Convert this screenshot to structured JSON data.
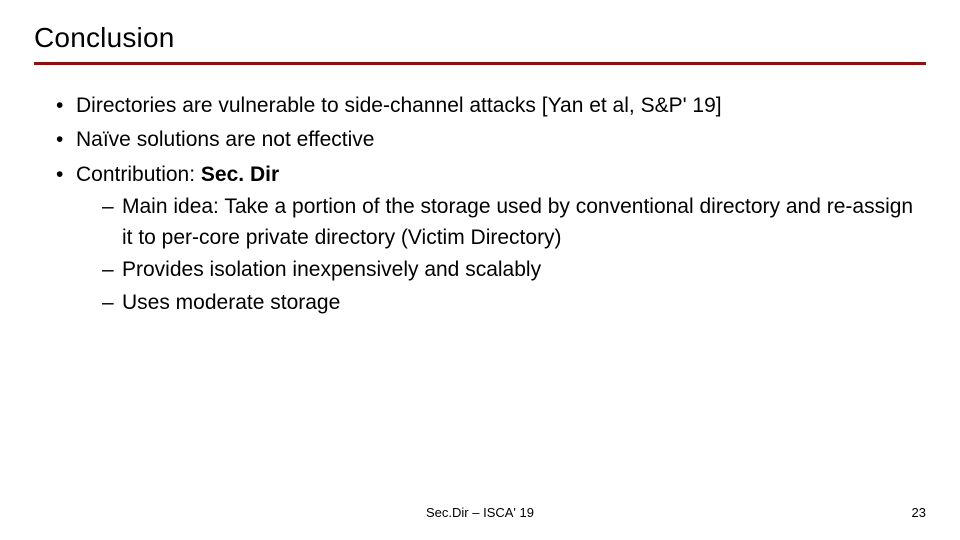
{
  "title": "Conclusion",
  "bullets": {
    "b1": "Directories are vulnerable to side-channel attacks [Yan et al, S&P' 19]",
    "b2": "Naïve solutions are not effective",
    "b3_prefix": "Contribution: ",
    "b3_bold": "Sec. Dir",
    "sub1": "Main idea: Take a portion of the storage used by conventional directory and re-assign it to per-core private directory (Victim Directory)",
    "sub2": "Provides isolation inexpensively and scalably",
    "sub3": "Uses moderate storage"
  },
  "footer_center": "Sec.Dir – ISCA' 19",
  "page_number": "23"
}
